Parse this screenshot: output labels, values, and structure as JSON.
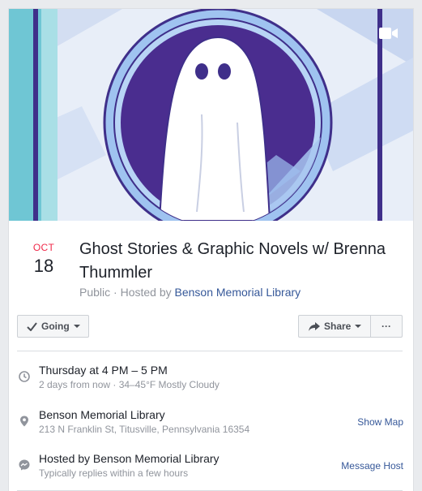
{
  "event": {
    "month": "OCT",
    "day": "18",
    "title": "Ghost Stories & Graphic Novels w/ Brenna Thummler",
    "privacy": "Public",
    "hosted_prefix": " · Hosted by ",
    "host_name": "Benson Memorial Library"
  },
  "actions": {
    "going_label": "Going",
    "share_label": "Share",
    "more_label": "···"
  },
  "details": {
    "time": {
      "main": "Thursday at 4 PM – 5 PM",
      "sub": "2 days from now · 34–45°F Mostly Cloudy"
    },
    "location": {
      "main": "Benson Memorial Library",
      "sub": "213 N Franklin St, Titusville, Pennsylvania 16354",
      "action": "Show Map"
    },
    "host": {
      "main": "Hosted by Benson Memorial Library",
      "sub": "Typically replies within a few hours",
      "action": "Message Host"
    }
  },
  "icons": {
    "cover_video": "video-camera-icon",
    "time": "clock-icon",
    "location": "map-pin-icon",
    "host": "messenger-icon",
    "going": "checkmark-icon",
    "share": "share-arrow-icon"
  },
  "colors": {
    "link": "#365899",
    "month": "#f02849",
    "cover_purple": "#4a2d8f",
    "cover_blue": "#8fb4ea"
  }
}
